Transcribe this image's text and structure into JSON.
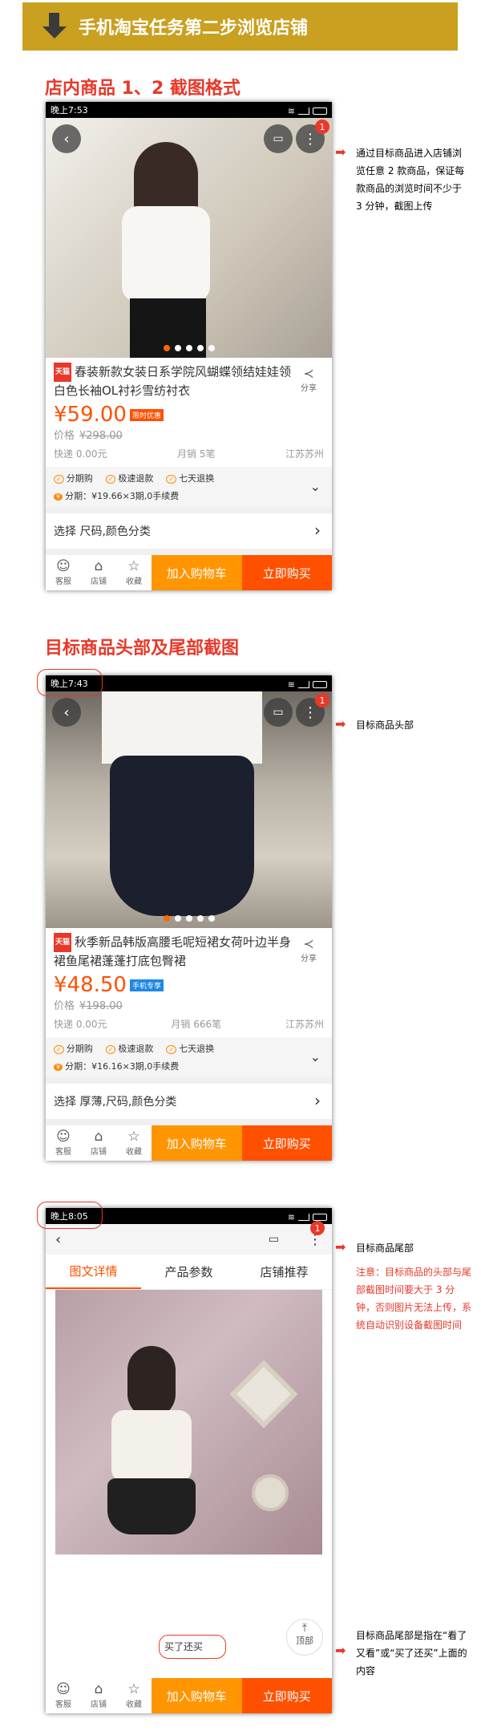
{
  "banner": {
    "title": "手机淘宝任务第二步浏览店铺"
  },
  "section1": {
    "title": "店内商品 1、2 截图格式",
    "status_time": "晚上7:53",
    "badge": "1",
    "tmall_tag": "天猫",
    "product_name": "春装新款女装日系学院风蝴蝶领结娃娃领白色长袖OL衬衫雪纺衬衣",
    "share_label": "分享",
    "price": "¥59.00",
    "price_tag": "限时优惠",
    "orig_label": "价格",
    "orig_price": "¥298.00",
    "shipping": "快递 0.00元",
    "monthly": "月销 5笔",
    "location": "江苏苏州",
    "svc1": "分期购",
    "svc2": "极速退款",
    "svc3": "七天退换",
    "installment": "分期：¥19.66×3期,0手续费",
    "select": "选择 尺码,颜色分类",
    "note": "通过目标商品进入店铺浏览任意 2 款商品，保证每款商品的浏览时间不少于 3 分钟，截图上传"
  },
  "section2": {
    "title": "目标商品头部及尾部截图",
    "status_time": "晚上7:43",
    "badge": "1",
    "tmall_tag": "天猫",
    "product_name": "秋季新品韩版高腰毛呢短裙女荷叶边半身裙鱼尾裙蓬蓬打底包臀裙",
    "share_label": "分享",
    "price": "¥48.50",
    "price_tag": "手机专享",
    "orig_label": "价格",
    "orig_price": "¥198.00",
    "shipping": "快递 0.00元",
    "monthly": "月销 666笔",
    "location": "江苏苏州",
    "svc1": "分期购",
    "svc2": "极速退款",
    "svc3": "七天退换",
    "installment": "分期：¥16.16×3期,0手续费",
    "select": "选择 厚薄,尺码,颜色分类",
    "note": "目标商品头部"
  },
  "section3": {
    "status_time": "晚上8:05",
    "badge": "1",
    "tabs": [
      "图文详情",
      "产品参数",
      "店铺推荐"
    ],
    "bought": "买了还买",
    "totop": "顶部",
    "note_title": "目标商品尾部",
    "note_warn": "注意：目标商品的头部与尾部截图时间要大于 3 分钟，否则图片无法上传，系统自动识别设备截图时间",
    "note_tail": "目标商品尾部是指在“看了又看”或“买了还买”上面的内容"
  },
  "bottom_bar": {
    "service": "客服",
    "shop": "店铺",
    "fav": "收藏",
    "cart": "加入购物车",
    "buy": "立即购买"
  },
  "colors": {
    "accent": "#ff5000",
    "red": "#e8382a",
    "cart": "#ff9500",
    "banner": "#c9a020"
  }
}
